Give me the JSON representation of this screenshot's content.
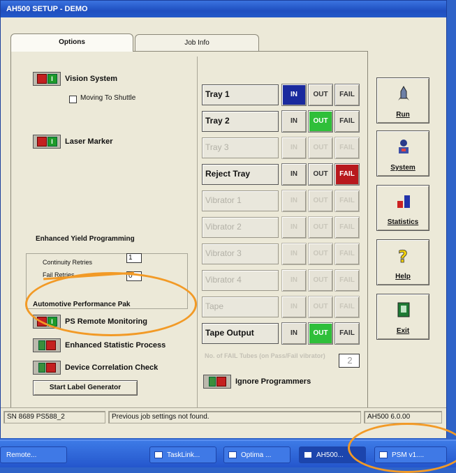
{
  "window": {
    "title": "AH500 SETUP - DEMO"
  },
  "tabs": [
    {
      "label": "Options",
      "selected": true
    },
    {
      "label": "Job Info",
      "selected": false
    }
  ],
  "options": {
    "vision_system": "Vision System",
    "moving_to_shuttle": "Moving To Shuttle",
    "laser_marker": "Laser Marker"
  },
  "yield": {
    "title": "Enhanced Yield Programming",
    "continuity_label": "Continuity Retries",
    "continuity_value": "1",
    "fail_label": "Fail Retries",
    "fail_value": "0"
  },
  "automotive": {
    "title": "Automotive Performance Pak",
    "ps_remote": "PS Remote Monitoring",
    "enhanced_stat": "Enhanced Statistic Process",
    "device_corr": "Device Correlation Check",
    "start_label": "Start Label Generator"
  },
  "trays": [
    {
      "label": "Tray 1",
      "enabled": true,
      "states": [
        "IN",
        "OUT",
        "FAIL"
      ],
      "selected": "IN"
    },
    {
      "label": "Tray 2",
      "enabled": true,
      "states": [
        "IN",
        "OUT",
        "FAIL"
      ],
      "selected": "OUT"
    },
    {
      "label": "Tray 3",
      "enabled": false,
      "states": [
        "IN",
        "OUT",
        "FAIL"
      ],
      "selected": ""
    },
    {
      "label": "Reject Tray",
      "enabled": true,
      "states": [
        "IN",
        "OUT",
        "FAIL"
      ],
      "selected": "FAIL"
    },
    {
      "label": "Vibrator 1",
      "enabled": false,
      "states": [
        "IN",
        "OUT",
        "FAIL"
      ],
      "selected": ""
    },
    {
      "label": "Vibrator 2",
      "enabled": false,
      "states": [
        "IN",
        "OUT",
        "FAIL"
      ],
      "selected": ""
    },
    {
      "label": "Vibrator 3",
      "enabled": false,
      "states": [
        "IN",
        "OUT",
        "FAIL"
      ],
      "selected": ""
    },
    {
      "label": "Vibrator 4",
      "enabled": false,
      "states": [
        "IN",
        "OUT",
        "FAIL"
      ],
      "selected": ""
    },
    {
      "label": "Tape",
      "enabled": false,
      "states": [
        "IN",
        "OUT",
        "FAIL"
      ],
      "selected": ""
    },
    {
      "label": "Tape Output",
      "enabled": true,
      "states": [
        "IN",
        "OUT",
        "FAIL"
      ],
      "selected": "OUT"
    }
  ],
  "fail_tubes": {
    "label": "No. of FAIL Tubes (on Pass/Fail vibrator)",
    "value": "2"
  },
  "ignore_programmers": "Ignore Programmers",
  "side_buttons": [
    {
      "label": "Run",
      "icon": "rocket-icon"
    },
    {
      "label": "System",
      "icon": "operator-icon"
    },
    {
      "label": "Statistics",
      "icon": "bar-chart-icon"
    },
    {
      "label": "Help",
      "icon": "question-icon"
    },
    {
      "label": "Exit",
      "icon": "door-icon"
    }
  ],
  "status": {
    "serial": "SN 8689 PS588_2",
    "message": "Previous job settings not found.",
    "version": "AH500 6.0.00"
  },
  "taskbar": [
    {
      "label": "Remote..."
    },
    {
      "label": "TaskLink..."
    },
    {
      "label": "Optima ..."
    },
    {
      "label": "AH500..."
    },
    {
      "label": "PSM v1...."
    }
  ],
  "colors": {
    "annotation": "#f29a26",
    "selected_in": "#1a2a9e",
    "selected_out": "#2fbf3a",
    "selected_fail": "#b8191d"
  }
}
